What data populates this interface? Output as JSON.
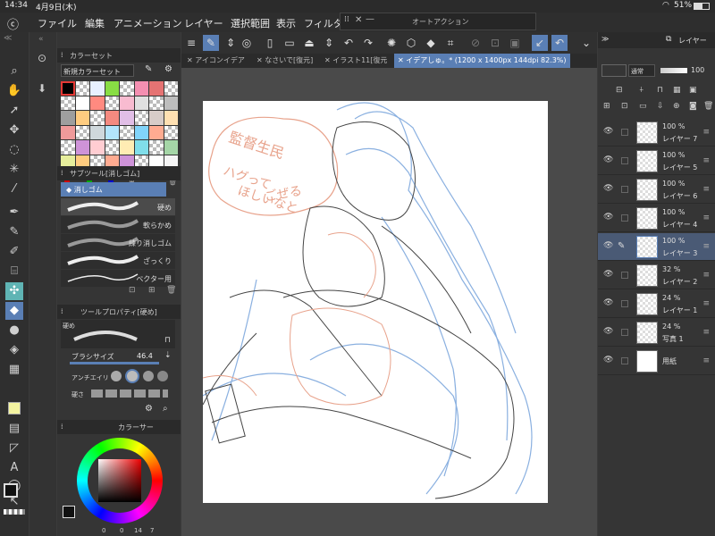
{
  "status": {
    "time": "14:34",
    "date": "4月9日(木)",
    "battery": "51%"
  },
  "menu": [
    "ファイル",
    "編集",
    "アニメーション",
    "レイヤー",
    "選択範囲",
    "表示",
    "フィルタ"
  ],
  "autoaction": {
    "title": "オートアクション"
  },
  "tabs": [
    "アイコンイデア",
    "なさいで[復元]",
    "イラスト11[復元",
    "イデアしゅ。* (1200 x 1400px 144dpi 82.3%)"
  ],
  "colorset": {
    "title": "カラーセット",
    "preset": "新規カラーセット"
  },
  "subtool": {
    "title": "サブツール[消しゴム]",
    "active": "消しゴム",
    "items": [
      "硬め",
      "軟らかめ",
      "練り消しゴム",
      "ざっくり",
      "ベクター用"
    ]
  },
  "toolprop": {
    "title": "ツールプロパティ[硬め]",
    "name": "硬め",
    "brush_size_label": "ブラシサイズ",
    "brush_size": "46.4",
    "antialias_label": "アンチエイリ",
    "hardness_label": "硬さ"
  },
  "colorwheel": {
    "title": "カラーサー",
    "values": [
      "0",
      "0",
      "14",
      "7"
    ]
  },
  "layers_panel": {
    "title": "レイヤー",
    "blend": "通常",
    "opacity": "100"
  },
  "layers": [
    {
      "name": "レイヤー 7",
      "opacity": "100 %"
    },
    {
      "name": "レイヤー 5",
      "opacity": "100 %"
    },
    {
      "name": "レイヤー 6",
      "opacity": "100 %"
    },
    {
      "name": "レイヤー 4",
      "opacity": "100 %"
    },
    {
      "name": "レイヤー 3",
      "opacity": "100 %"
    },
    {
      "name": "レイヤー 2",
      "opacity": "32 %"
    },
    {
      "name": "レイヤー 1",
      "opacity": "24 %"
    },
    {
      "name": "写真 1",
      "opacity": "24 %"
    },
    {
      "name": "用紙",
      "opacity": ""
    }
  ],
  "canvas_text": [
    "監督生民",
    "ハグって",
    "ほしいなと",
    "ごぜる"
  ],
  "colors": {
    "accent": "#5a7fb5",
    "main_color": "#111111",
    "sketch_red": "#e8a38c",
    "sketch_blue": "#8ab0e0"
  }
}
